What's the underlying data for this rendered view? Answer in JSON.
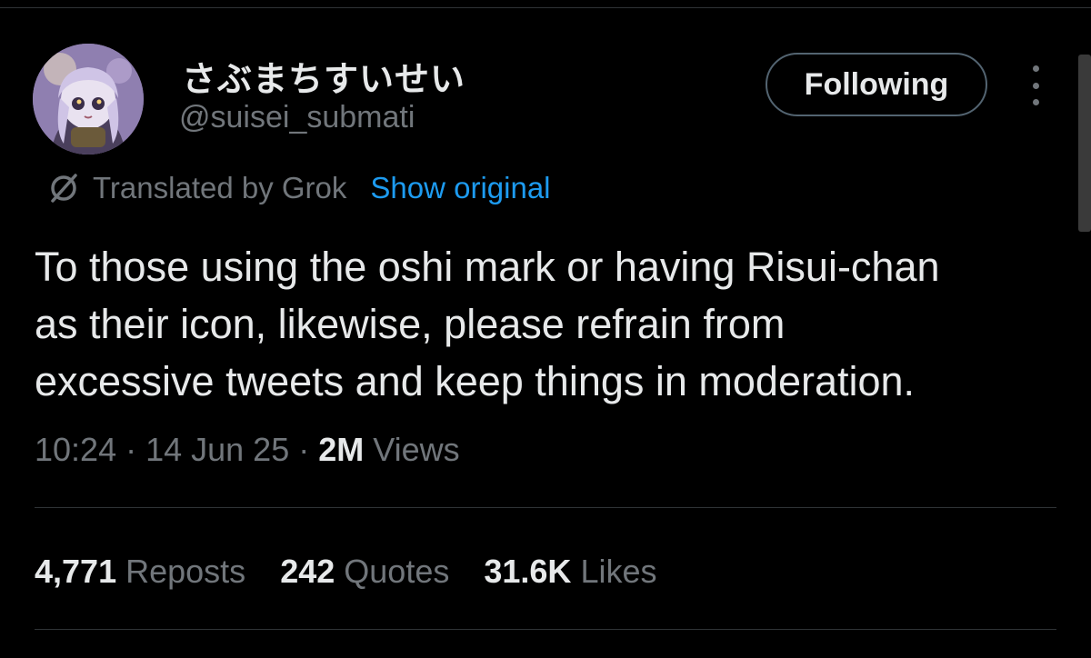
{
  "user": {
    "display_name": "さぶまちすいせい",
    "handle": "@suisei_submati",
    "avatar": "avatar-image",
    "follow_label": "Following"
  },
  "translation": {
    "icon": "translate-icon",
    "label": "Translated by Grok",
    "show_original_label": "Show original"
  },
  "tweet": {
    "lines": [
      "To those using the oshi mark or having Risui-chan",
      "as their icon, likewise, please refrain from",
      "excessive tweets and keep things in moderation."
    ],
    "time": "10:24",
    "date": "14 Jun 25",
    "views_count": "2M",
    "views_label": "Views"
  },
  "stats": [
    {
      "count": "4,771",
      "label": "Reposts"
    },
    {
      "count": "242",
      "label": "Quotes"
    },
    {
      "count": "31.6K",
      "label": "Likes"
    }
  ],
  "colors": {
    "background": "#000000",
    "text_primary": "#e7e9ea",
    "text_secondary": "#71767b",
    "link": "#1d9bf0",
    "border": "#2f3336"
  }
}
